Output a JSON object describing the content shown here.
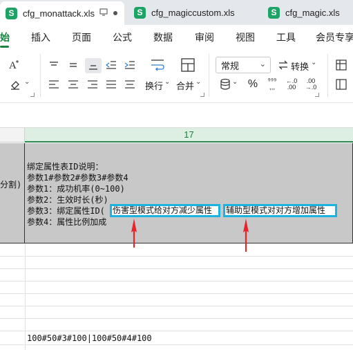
{
  "tabs": [
    {
      "label": "cfg_monattack.xls",
      "logo": "S",
      "active": true
    },
    {
      "label": "cfg_magiccustom.xls",
      "logo": "S",
      "active": false
    },
    {
      "label": "cfg_magic.xls",
      "logo": "S",
      "active": false
    }
  ],
  "menu": {
    "items": [
      "始",
      "插入",
      "页面",
      "公式",
      "数据",
      "审阅",
      "视图",
      "工具",
      "会员专享"
    ],
    "active_index": 0
  },
  "ribbon": {
    "font_color_icon": "font-color-icon",
    "wrap_label": "换行",
    "merge_label": "合并",
    "number_format": "常规",
    "convert_label": "转换"
  },
  "grid": {
    "column_header": "17",
    "left_cell_text": "分割)",
    "cell_lines": [
      "绑定属性表ID说明：",
      "参数1#参数2#参数3#参数4",
      "参数1：成功机率(0~100)",
      "参数2：生效时长(秒)",
      "参数3：绑定属性ID(",
      "参数4：属性比例加成"
    ],
    "highlight_1": "伤害型模式给对方减少属性",
    "highlight_2": "辅助型模式对对方增加属性",
    "bottom_cell": "100#50#3#100|100#50#4#100"
  },
  "colors": {
    "accent_green": "#17843f",
    "highlight_border": "#19b3e0",
    "arrow_red": "#e8242a",
    "cell_gray": "#c8c8c8"
  }
}
